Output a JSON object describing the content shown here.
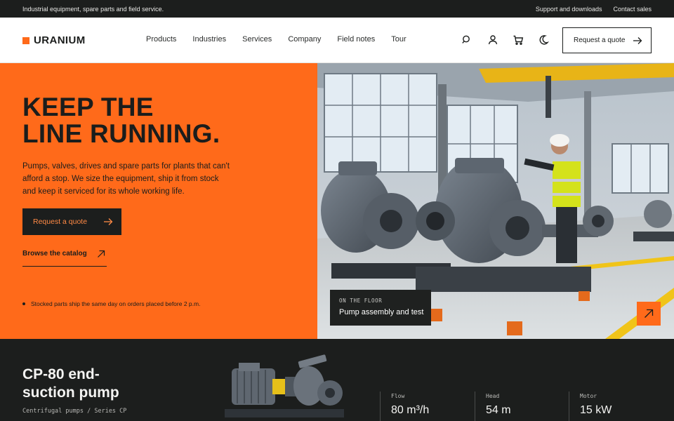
{
  "topbar": {
    "tagline": "Industrial equipment, spare parts and field service.",
    "support": "Support and downloads",
    "contact": "Contact sales"
  },
  "header": {
    "logo": "URANIUM",
    "nav": [
      "Products",
      "Industries",
      "Services",
      "Company",
      "Field notes",
      "Tour"
    ],
    "icons": [
      "search-icon",
      "user-icon",
      "cart-icon",
      "moon-icon"
    ],
    "quote_label": "Request a quote"
  },
  "hero": {
    "title_line1": "KEEP THE",
    "title_line2": "LINE RUNNING.",
    "body": "Pumps, valves, drives and spare parts for plants that can't afford a stop. We size the equipment, ship it from stock and keep it serviced for its whole working life.",
    "cta_label": "Request a quote",
    "link_label": "Browse the catalog",
    "note": "Stocked parts ship the same day on orders placed before 2 p.m."
  },
  "image_caption": {
    "kicker": "ON THE FLOOR",
    "title": "Pump assembly and test"
  },
  "product": {
    "name": "CP-80 end-suction pump",
    "subtitle": "Centrifugal pumps / Series CP",
    "specs": [
      {
        "label": "Flow",
        "value": "80 m³/h"
      },
      {
        "label": "Head",
        "value": "54 m"
      },
      {
        "label": "Motor",
        "value": "15 kW"
      }
    ]
  },
  "colors": {
    "accent": "#ff6a1a",
    "dark": "#1c1e1d",
    "light": "#ffffff"
  }
}
